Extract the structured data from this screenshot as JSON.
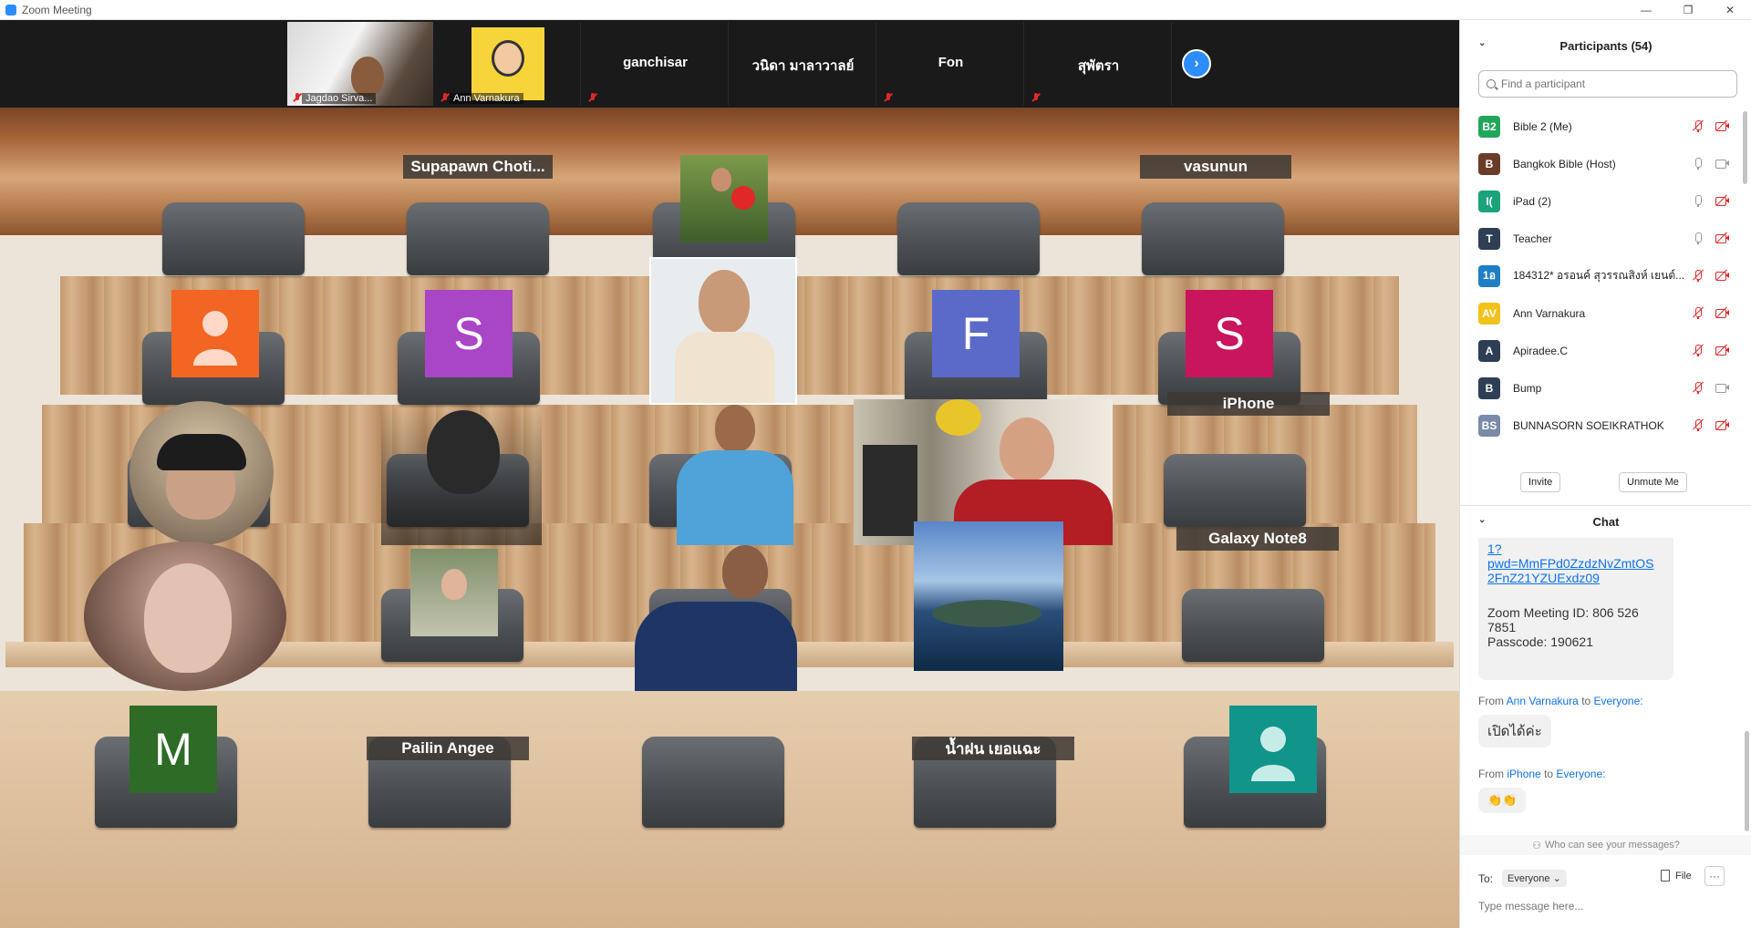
{
  "window": {
    "title": "Zoom Meeting",
    "controls": [
      "—",
      "❐",
      "✕"
    ]
  },
  "filmstrip": {
    "tiles": [
      {
        "name": "Jagdao Sirva...",
        "kind": "video"
      },
      {
        "name": "Ann Varnakura",
        "kind": "image"
      },
      {
        "name": "ganchisar",
        "kind": "name"
      },
      {
        "name": "วนิดา มาลาวาลย์",
        "kind": "name"
      },
      {
        "name": "Fon",
        "kind": "name"
      },
      {
        "name": "สุพัตรา",
        "kind": "name"
      }
    ],
    "next_icon": "chevron-right-icon"
  },
  "hall": {
    "nameplates": {
      "supapawn": "Supapawn  Choti...",
      "vasunun": "vasunun",
      "iphone": "iPhone",
      "galaxy": "Galaxy Note8",
      "pailin": "Pailin Angee",
      "namfon": "น้ำฝน เยอแฉะ"
    },
    "avatars": {
      "s1": "S",
      "f": "F",
      "s2": "S",
      "m": "M"
    },
    "colors": {
      "orange": "#f26522",
      "purple": "#a846c6",
      "slate_blue": "#5b6ac9",
      "crimson": "#c8155d",
      "dark_green": "#2e6b26",
      "teal": "#11948a"
    }
  },
  "participants": {
    "header": "Participants (54)",
    "search_placeholder": "Find a participant",
    "rows": [
      {
        "initials": "B2",
        "color": "#22a65a",
        "name": "Bible 2 (Me)",
        "mic": "off",
        "cam": "off"
      },
      {
        "initials": "B",
        "color": "#6b3b2a",
        "name": "Bangkok Bible (Host)",
        "mic": "on",
        "cam": "on"
      },
      {
        "initials": "I(",
        "color": "#19a37a",
        "name": "iPad (2)",
        "mic": "on",
        "cam": "off"
      },
      {
        "initials": "T",
        "color": "#2e3e55",
        "name": "Teacher",
        "mic": "on",
        "cam": "off"
      },
      {
        "initials": "1อ",
        "color": "#1e7fc5",
        "name": "184312* อรอนค์ สุวรรณสิงห์ เยนต์...",
        "mic": "off",
        "cam": "off"
      },
      {
        "initials": "AV",
        "color": "#f1c21b",
        "name": "Ann Varnakura",
        "mic": "off",
        "cam": "off"
      },
      {
        "initials": "A",
        "color": "#2e3e55",
        "name": "Apiradee.C",
        "mic": "off",
        "cam": "off"
      },
      {
        "initials": "B",
        "color": "#2e3e55",
        "name": "Bump",
        "mic": "off",
        "cam": "on"
      },
      {
        "initials": "BS",
        "color": "#7a8aa8",
        "name": "BUNNASORN SOEIKRATHOK",
        "mic": "off",
        "cam": "off"
      }
    ],
    "invite": "Invite",
    "unmute": "Unmute Me"
  },
  "chat": {
    "header": "Chat",
    "link_lines": [
      "1?",
      "pwd=MmFPd0ZzdzNvZmtOS",
      "2FnZ21YZUExdz09"
    ],
    "meeting_id_lines": [
      "Zoom Meeting ID: 806 526",
      "7851",
      "Passcode: 190621"
    ],
    "messages": [
      {
        "from_label": "From",
        "sender": "Ann Varnakura",
        "to_label": "to",
        "recipient": "Everyone:",
        "text": "เปิดได้ค่ะ"
      },
      {
        "from_label": "From",
        "sender": "iPhone",
        "to_label": "to",
        "recipient": "Everyone:",
        "text": "👏👏"
      }
    ],
    "who_can_see": "Who can see your messages?",
    "to_label": "To:",
    "to_value": "Everyone",
    "file_label": "File",
    "more_label": "···",
    "input_placeholder": "Type message here..."
  }
}
